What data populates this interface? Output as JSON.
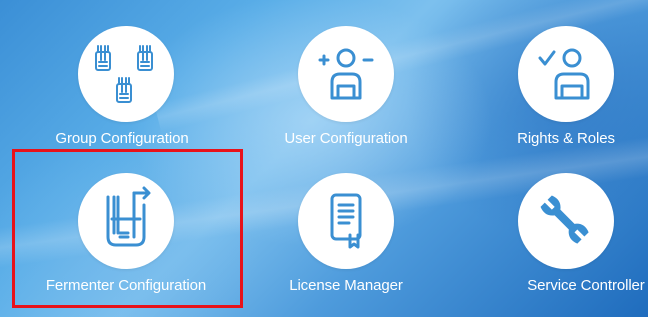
{
  "tiles": [
    {
      "label": "Group Configuration",
      "icon": "bioreactor-group-icon"
    },
    {
      "label": "User Configuration",
      "icon": "user-config-icon"
    },
    {
      "label": "Rights & Roles",
      "icon": "user-check-icon"
    },
    {
      "label": "Fermenter Configuration",
      "icon": "fermenter-icon"
    },
    {
      "label": "License Manager",
      "icon": "license-document-icon"
    },
    {
      "label": "Service Controller",
      "icon": "wrench-icon"
    }
  ],
  "colors": {
    "icon": "#3a8fd2",
    "selection_border": "#e8121a",
    "label": "#ffffff"
  },
  "selected_tile": "Fermenter Configuration"
}
